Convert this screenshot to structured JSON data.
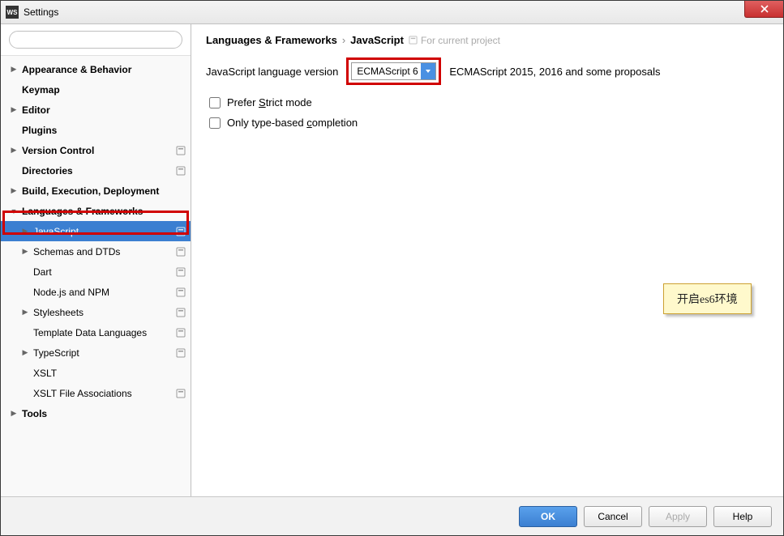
{
  "window": {
    "app_badge": "WS",
    "title": "Settings"
  },
  "search": {
    "placeholder": ""
  },
  "sidebar": {
    "items": [
      {
        "label": "Appearance & Behavior",
        "bold": true,
        "depth": 0,
        "arrow": "right",
        "proj": false
      },
      {
        "label": "Keymap",
        "bold": true,
        "depth": 0,
        "arrow": "",
        "proj": false
      },
      {
        "label": "Editor",
        "bold": true,
        "depth": 0,
        "arrow": "right",
        "proj": false
      },
      {
        "label": "Plugins",
        "bold": true,
        "depth": 0,
        "arrow": "",
        "proj": false
      },
      {
        "label": "Version Control",
        "bold": true,
        "depth": 0,
        "arrow": "right",
        "proj": true
      },
      {
        "label": "Directories",
        "bold": true,
        "depth": 0,
        "arrow": "",
        "proj": true
      },
      {
        "label": "Build, Execution, Deployment",
        "bold": true,
        "depth": 0,
        "arrow": "right",
        "proj": false
      },
      {
        "label": "Languages & Frameworks",
        "bold": true,
        "depth": 0,
        "arrow": "down",
        "proj": false
      },
      {
        "label": "JavaScript",
        "bold": false,
        "depth": 1,
        "arrow": "right",
        "proj": true,
        "selected": true
      },
      {
        "label": "Schemas and DTDs",
        "bold": false,
        "depth": 1,
        "arrow": "right",
        "proj": true
      },
      {
        "label": "Dart",
        "bold": false,
        "depth": 1,
        "arrow": "",
        "proj": true
      },
      {
        "label": "Node.js and NPM",
        "bold": false,
        "depth": 1,
        "arrow": "",
        "proj": true
      },
      {
        "label": "Stylesheets",
        "bold": false,
        "depth": 1,
        "arrow": "right",
        "proj": true
      },
      {
        "label": "Template Data Languages",
        "bold": false,
        "depth": 1,
        "arrow": "",
        "proj": true
      },
      {
        "label": "TypeScript",
        "bold": false,
        "depth": 1,
        "arrow": "right",
        "proj": true
      },
      {
        "label": "XSLT",
        "bold": false,
        "depth": 1,
        "arrow": "",
        "proj": false
      },
      {
        "label": "XSLT File Associations",
        "bold": false,
        "depth": 1,
        "arrow": "",
        "proj": true
      },
      {
        "label": "Tools",
        "bold": true,
        "depth": 0,
        "arrow": "right",
        "proj": false
      }
    ]
  },
  "breadcrumb": {
    "crumb1": "Languages & Frameworks",
    "crumb2": "JavaScript",
    "hint": "For current project"
  },
  "main": {
    "version_label": "JavaScript language version",
    "version_value": "ECMAScript 6",
    "version_desc": "ECMAScript 2015, 2016 and some proposals",
    "cb_strict": "Prefer Strict mode",
    "cb_typecomp": "Only type-based completion"
  },
  "annotation": {
    "text": "开启es6环境"
  },
  "footer": {
    "ok": "OK",
    "cancel": "Cancel",
    "apply": "Apply",
    "help": "Help"
  }
}
